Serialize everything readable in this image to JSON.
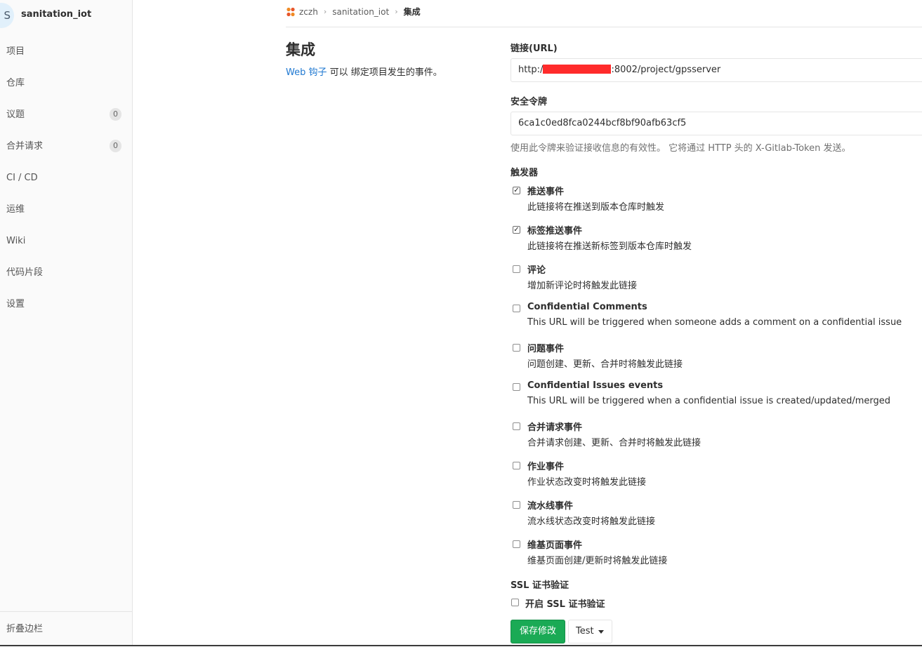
{
  "sidebar": {
    "avatar_letter": "S",
    "project_name": "sanitation_iot",
    "items": [
      {
        "label": "项目"
      },
      {
        "label": "仓库"
      },
      {
        "label": "议题",
        "badge": "0"
      },
      {
        "label": "合并请求",
        "badge": "0"
      },
      {
        "label": "CI / CD"
      },
      {
        "label": "运维"
      },
      {
        "label": "Wiki"
      },
      {
        "label": "代码片段"
      },
      {
        "label": "设置"
      }
    ],
    "collapse_label": "折叠边栏"
  },
  "breadcrumb": {
    "group": "zczh",
    "project": "sanitation_iot",
    "current": "集成"
  },
  "page": {
    "title": "集成",
    "desc_link": "Web 钩子",
    "desc_text": " 可以 绑定项目发生的事件。"
  },
  "form": {
    "url_label": "链接(URL)",
    "url_prefix": "http:/",
    "url_suffix": ":8002/project/gpsserver",
    "token_label": "安全令牌",
    "token_value": "6ca1c0ed8fca0244bcf8bf90afb63cf5",
    "token_help": "使用此令牌来验证接收信息的有效性。 它将通过 HTTP 头的 X-Gitlab-Token 发送。",
    "triggers_label": "触发器",
    "triggers": [
      {
        "title": "推送事件",
        "desc": "此链接将在推送到版本仓库时触发",
        "checked": true
      },
      {
        "title": "标签推送事件",
        "desc": "此链接将在推送新标签到版本仓库时触发",
        "checked": true
      },
      {
        "title": "评论",
        "desc": "增加新评论时将触发此链接",
        "checked": false
      },
      {
        "title": "Confidential Comments",
        "desc": "This URL will be triggered when someone adds a comment on a confidential issue",
        "checked": false
      },
      {
        "title": "问题事件",
        "desc": "问题创建、更新、合并时将触发此链接",
        "checked": false
      },
      {
        "title": "Confidential Issues events",
        "desc": "This URL will be triggered when a confidential issue is created/updated/merged",
        "checked": false
      },
      {
        "title": "合并请求事件",
        "desc": "合并请求创建、更新、合并时将触发此链接",
        "checked": false
      },
      {
        "title": "作业事件",
        "desc": "作业状态改变时将触发此链接",
        "checked": false
      },
      {
        "title": "流水线事件",
        "desc": "流水线状态改变时将触发此链接",
        "checked": false
      },
      {
        "title": "维基页面事件",
        "desc": "维基页面创建/更新时将触发此链接",
        "checked": false
      }
    ],
    "ssl_label": "SSL 证书验证",
    "ssl_checkbox_label": "开启 SSL 证书验证",
    "ssl_checked": false,
    "save_label": "保存修改",
    "test_label": "Test"
  },
  "colors": {
    "save_button": "#1aaa55",
    "link": "#1f78d1",
    "redaction": "#ff2b2b"
  }
}
